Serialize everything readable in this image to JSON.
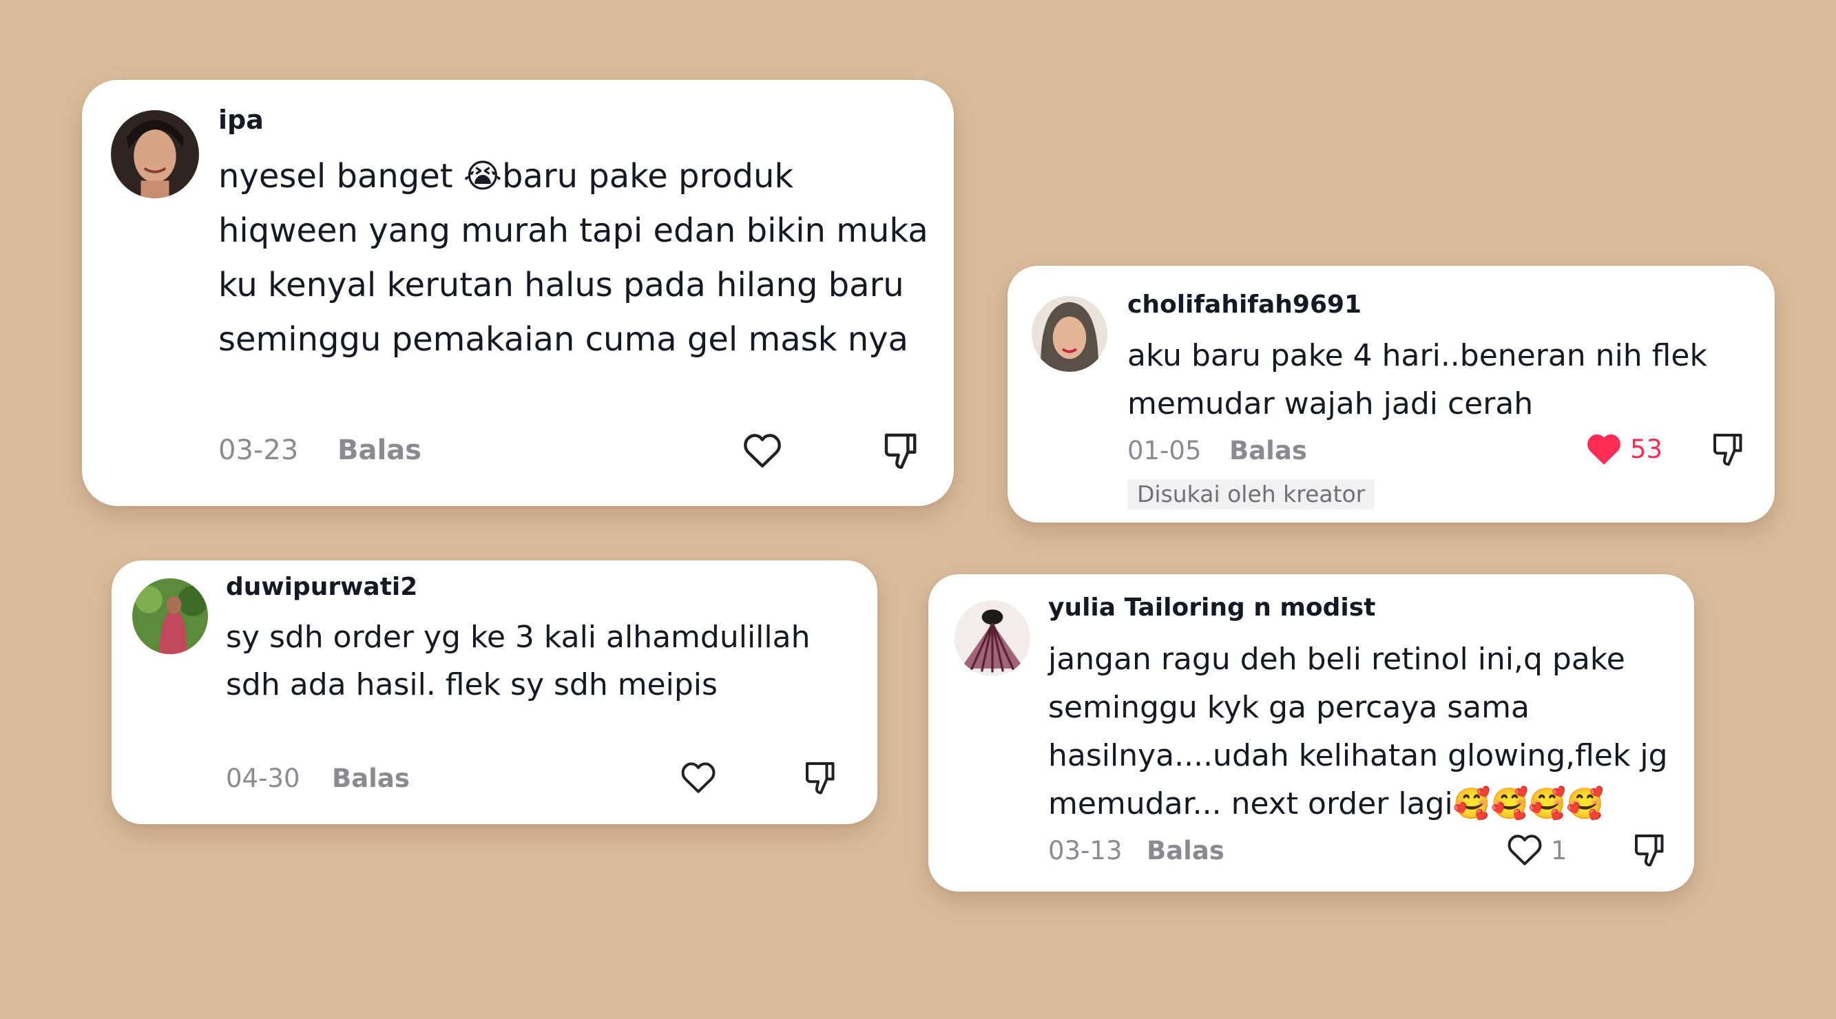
{
  "comments": [
    {
      "username": "ipa",
      "text": "nyesel banget 😭baru pake produk hiqween yang murah tapi edan bikin muka ku kenyal kerutan halus pada hilang baru seminggu pemakaian cuma gel mask nya",
      "date": "03-23",
      "reply_label": "Balas",
      "liked": false,
      "like_count": ""
    },
    {
      "username": "cholifahifah9691",
      "text": "aku baru pake 4 hari..beneran nih flek memudar wajah jadi cerah",
      "date": "01-05",
      "reply_label": "Balas",
      "liked": true,
      "like_count": "53",
      "badge": "Disukai oleh kreator"
    },
    {
      "username": "duwipurwati2",
      "text": "sy sdh order yg ke 3 kali alhamdulillah sdh ada hasil. flek sy sdh meipis",
      "date": "04-30",
      "reply_label": "Balas",
      "liked": false,
      "like_count": ""
    },
    {
      "username": "yulia Tailoring n modist",
      "text": "jangan ragu deh beli retinol ini,q pake seminggu kyk ga percaya sama hasilnya....udah kelihatan glowing,flek jg memudar... next order lagi🥰🥰🥰🥰",
      "date": "03-13",
      "reply_label": "Balas",
      "liked": false,
      "like_count": "1"
    }
  ],
  "icons": {
    "like": "heart-outline-icon",
    "liked": "heart-filled-icon",
    "dislike": "thumbs-down-icon"
  },
  "colors": {
    "background": "#d9bc9d",
    "card": "#ffffff",
    "text": "#161823",
    "muted": "#8a8b91",
    "liked": "#fe2c55"
  }
}
